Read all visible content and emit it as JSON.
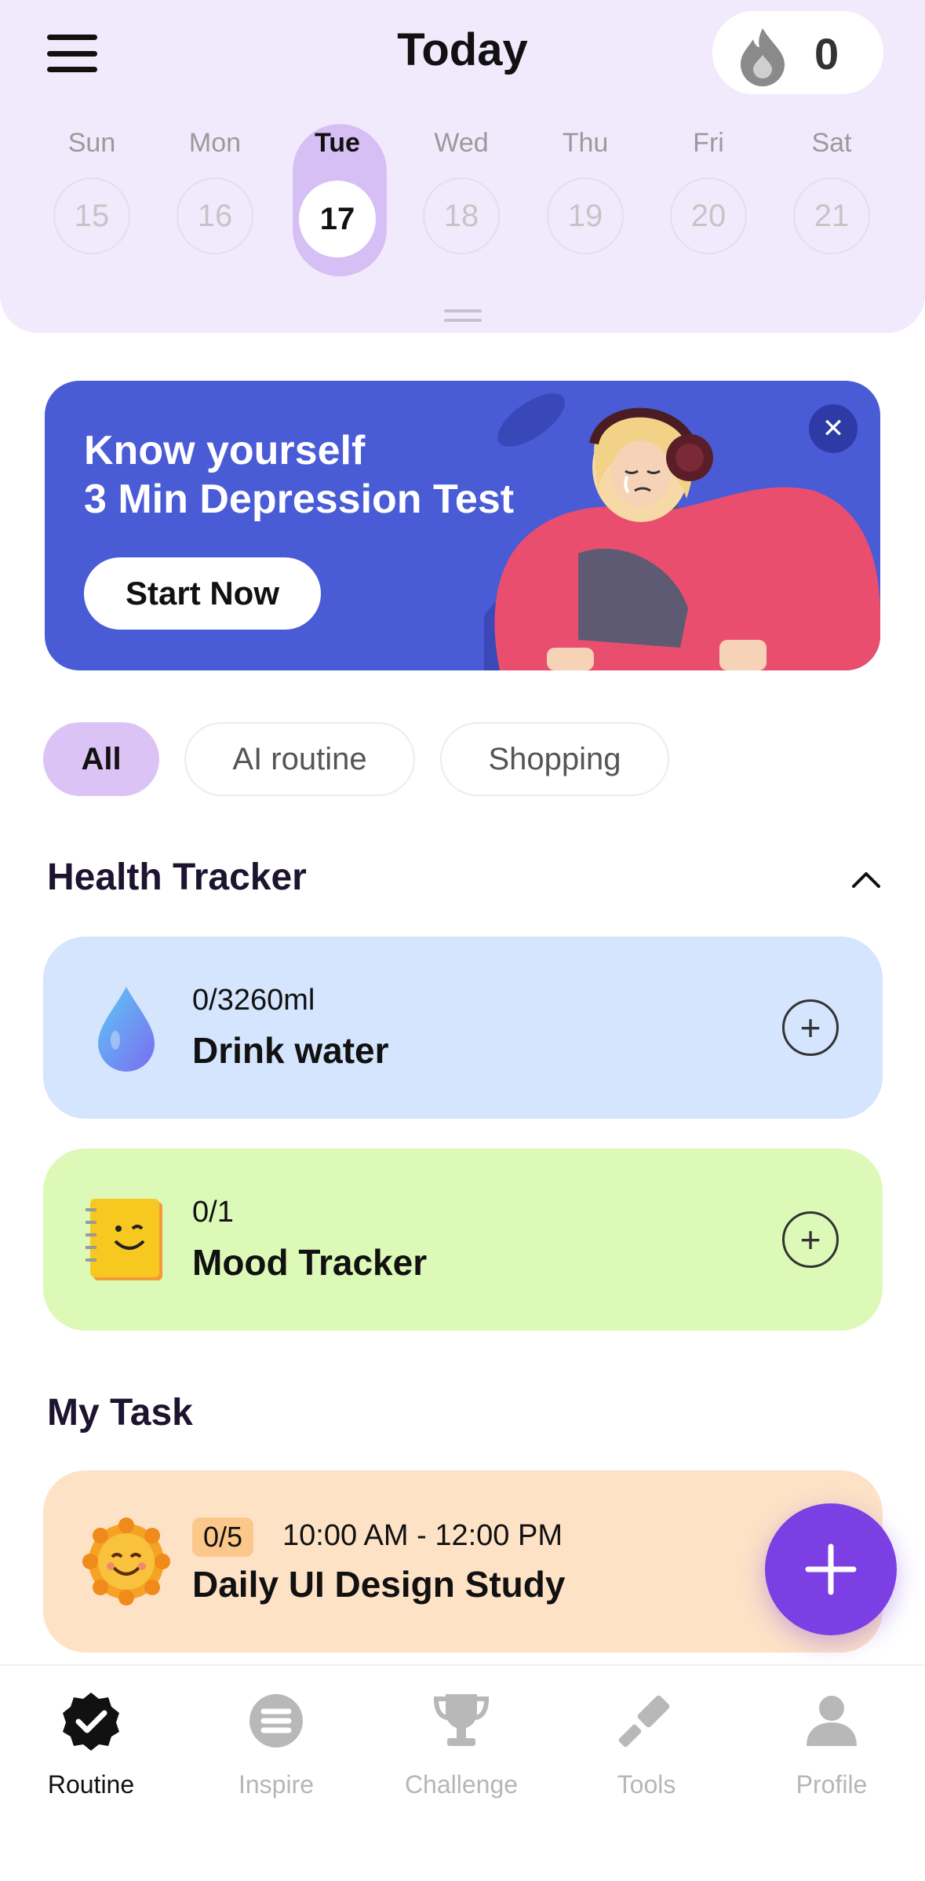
{
  "header": {
    "title": "Today",
    "streak_count": "0",
    "days": [
      {
        "name": "Sun",
        "num": "15"
      },
      {
        "name": "Mon",
        "num": "16"
      },
      {
        "name": "Tue",
        "num": "17",
        "active": true
      },
      {
        "name": "Wed",
        "num": "18"
      },
      {
        "name": "Thu",
        "num": "19"
      },
      {
        "name": "Fri",
        "num": "20"
      },
      {
        "name": "Sat",
        "num": "21"
      }
    ]
  },
  "banner": {
    "line1": "Know yourself",
    "line2": "3 Min Depression Test",
    "cta": "Start Now",
    "close_icon": "close-icon"
  },
  "filters": [
    "All",
    "AI routine",
    "Shopping"
  ],
  "health_tracker": {
    "title": "Health Tracker",
    "items": [
      {
        "progress": "0/3260ml",
        "name": "Drink water",
        "icon": "water-drop-icon"
      },
      {
        "progress": "0/1",
        "name": "Mood Tracker",
        "icon": "notebook-icon"
      }
    ]
  },
  "my_task": {
    "title": "My Task",
    "items": [
      {
        "badge": "0/5",
        "time": "10:00 AM - 12:00 PM",
        "name": "Daily UI Design Study",
        "icon": "sun-icon"
      }
    ]
  },
  "nav": [
    {
      "label": "Routine",
      "icon": "routine-check-icon",
      "active": true
    },
    {
      "label": "Inspire",
      "icon": "inspire-icon"
    },
    {
      "label": "Challenge",
      "icon": "trophy-icon"
    },
    {
      "label": "Tools",
      "icon": "tools-icon"
    },
    {
      "label": "Profile",
      "icon": "profile-icon"
    }
  ],
  "colors": {
    "accent": "#7b3fe4",
    "header_bg": "#f1eafd",
    "banner_bg": "#4a5bd6",
    "water_card": "#d4e5fd",
    "mood_card": "#dcf9b8",
    "task_card": "#fde2c6"
  }
}
